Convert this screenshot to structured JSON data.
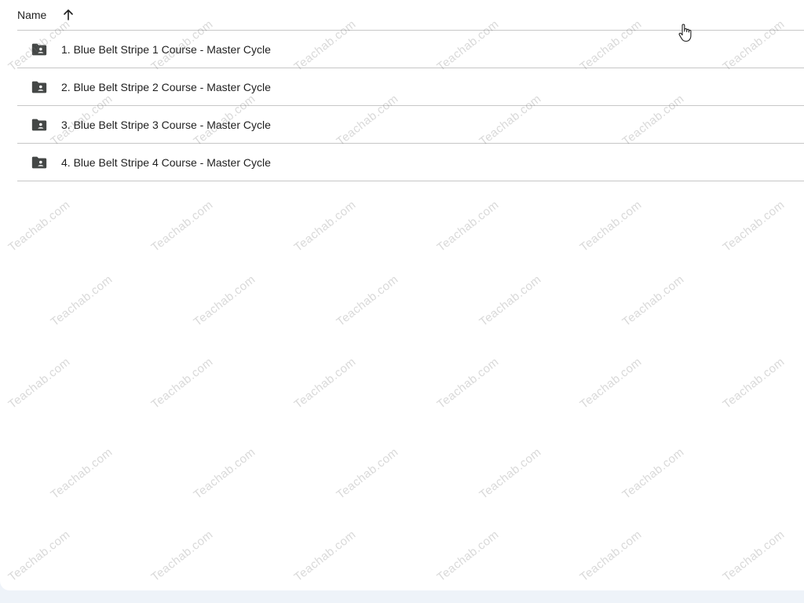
{
  "header": {
    "name_label": "Name",
    "sort_icon": "arrow-up-icon"
  },
  "files": [
    {
      "label": "1. Blue Belt Stripe 1 Course - Master Cycle",
      "icon": "shared-folder-icon"
    },
    {
      "label": "2. Blue Belt Stripe 2 Course - Master Cycle",
      "icon": "shared-folder-icon"
    },
    {
      "label": "3. Blue Belt Stripe 3 Course - Master Cycle",
      "icon": "shared-folder-icon"
    },
    {
      "label": "4. Blue Belt Stripe 4 Course - Master Cycle",
      "icon": "shared-folder-icon"
    }
  ],
  "watermark": {
    "text": "Teachab.com"
  },
  "colors": {
    "text": "#1f1f1f",
    "divider": "#c7c7c7",
    "icon": "#444746",
    "page_bg": "#ffffff",
    "outer_bg": "#eef3f9"
  }
}
